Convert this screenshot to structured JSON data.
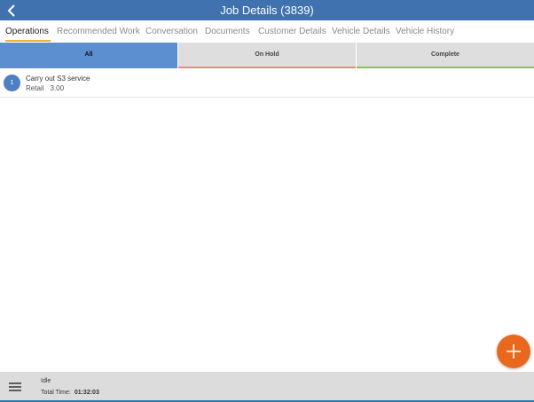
{
  "header": {
    "title": "Job Details (3839)",
    "back_icon": "chevron-left-icon"
  },
  "tabs": [
    {
      "label": "Operations",
      "active": true
    },
    {
      "label": "Recommended Work",
      "active": false
    },
    {
      "label": "Conversation",
      "active": false
    },
    {
      "label": "Documents",
      "active": false
    },
    {
      "label": "Customer Details",
      "active": false
    },
    {
      "label": "Vehicle Details",
      "active": false
    },
    {
      "label": "Vehicle History",
      "active": false
    }
  ],
  "filters": [
    {
      "label": "All",
      "active": true,
      "color": "#5b8fd0"
    },
    {
      "label": "On Hold",
      "active": false,
      "color": "#e98a7e"
    },
    {
      "label": "Complete",
      "active": false,
      "color": "#8cc152"
    }
  ],
  "operations": [
    {
      "number": "1",
      "name": "Carry out S3 service",
      "type": "Retail",
      "value": "3.00"
    }
  ],
  "fab": {
    "icon": "plus-icon",
    "color": "#e8691e"
  },
  "footer": {
    "menu_icon": "hamburger-menu-icon",
    "status": "Idle",
    "total_time_label": "Total Time:",
    "total_time_value": "01:32:03"
  },
  "colors": {
    "header": "#3f72ae",
    "tab_underline": "#e7b23d",
    "footer_accent": "#2a7fa8"
  }
}
